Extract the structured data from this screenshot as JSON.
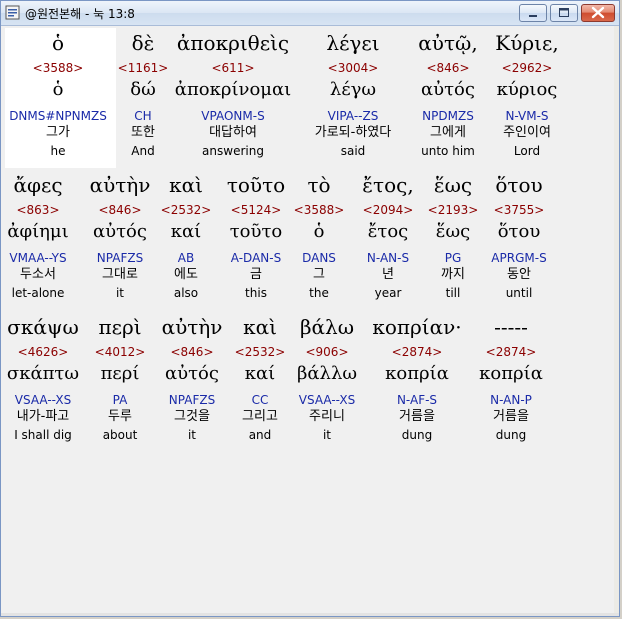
{
  "window": {
    "title": "@원전본해 - 눅 13:8"
  },
  "rows": [
    [
      {
        "greek": "ὁ",
        "strong": "<3588>",
        "lemma": "ὁ",
        "parse": "DNMS#NPNMZS",
        "korean": "그가",
        "english": "he"
      },
      {
        "greek": "δὲ",
        "strong": "<1161>",
        "lemma": "δώ",
        "parse": "CH",
        "korean": "또한",
        "english": "And"
      },
      {
        "greek": "ἀποκριθεὶς",
        "strong": "<611>",
        "lemma": "ἀποκρίνομαι",
        "parse": "VPAONM-S",
        "korean": "대답하여",
        "english": "answering"
      },
      {
        "greek": "λέγει",
        "strong": "<3004>",
        "lemma": "λέγω",
        "parse": "VIPA--ZS",
        "korean": "가로되-하였다",
        "english": "said"
      },
      {
        "greek": "αὐτῷ,",
        "strong": "<846>",
        "lemma": "αὐτός",
        "parse": "NPDMZS",
        "korean": "그에게",
        "english": "unto him"
      },
      {
        "greek": "Κύριε,",
        "strong": "<2962>",
        "lemma": "κύριος",
        "parse": "N-VM-S",
        "korean": "주인이여",
        "english": "Lord"
      }
    ],
    [
      {
        "greek": "ἄφες",
        "strong": "<863>",
        "lemma": "ἀφίημι",
        "parse": "VMAA--YS",
        "korean": "두소서",
        "english": "let-alone"
      },
      {
        "greek": "αὐτὴν",
        "strong": "<846>",
        "lemma": "αὐτός",
        "parse": "NPAFZS",
        "korean": "그대로",
        "english": "it"
      },
      {
        "greek": "καὶ",
        "strong": "<2532>",
        "lemma": "καί",
        "parse": "AB",
        "korean": "에도",
        "english": "also"
      },
      {
        "greek": "τοῦτο",
        "strong": "<5124>",
        "lemma": "τοῦτο",
        "parse": "A-DAN-S",
        "korean": "금",
        "english": "this"
      },
      {
        "greek": "τὸ",
        "strong": "<3588>",
        "lemma": "ὁ",
        "parse": "DANS",
        "korean": "그",
        "english": "the"
      },
      {
        "greek": "ἔτος,",
        "strong": "<2094>",
        "lemma": "ἔτος",
        "parse": "N-AN-S",
        "korean": "년",
        "english": "year"
      },
      {
        "greek": "ἕως",
        "strong": "<2193>",
        "lemma": "ἕως",
        "parse": "PG",
        "korean": "까지",
        "english": "till"
      },
      {
        "greek": "ὅτου",
        "strong": "<3755>",
        "lemma": "ὅτου",
        "parse": "APRGM-S",
        "korean": "동안",
        "english": "until"
      }
    ],
    [
      {
        "greek": "σκάψω",
        "strong": "<4626>",
        "lemma": "σκάπτω",
        "parse": "VSAA--XS",
        "korean": "내가-파고",
        "english": "I shall dig"
      },
      {
        "greek": "περὶ",
        "strong": "<4012>",
        "lemma": "περί",
        "parse": "PA",
        "korean": "두루",
        "english": "about"
      },
      {
        "greek": "αὐτὴν",
        "strong": "<846>",
        "lemma": "αὐτός",
        "parse": "NPAFZS",
        "korean": "그것을",
        "english": "it"
      },
      {
        "greek": "καὶ",
        "strong": "<2532>",
        "lemma": "καί",
        "parse": "CC",
        "korean": "그리고",
        "english": "and"
      },
      {
        "greek": "βάλω",
        "strong": "<906>",
        "lemma": "βάλλω",
        "parse": "VSAA--XS",
        "korean": "주리니",
        "english": "it"
      },
      {
        "greek": "κοπρίαν·",
        "strong": "<2874>",
        "lemma": "κοπρία",
        "parse": "N-AF-S",
        "korean": "거름을",
        "english": "dung"
      },
      {
        "greek": "-----",
        "strong": "<2874>",
        "lemma": "κοπρία",
        "parse": "N-AN-P",
        "korean": "거름을",
        "english": "dung"
      }
    ]
  ],
  "colors": {
    "strong": "#8b0000",
    "parse": "#1a2aa8",
    "text": "#000000",
    "selection": "#ffffff"
  },
  "icons": {
    "app": "app-icon",
    "minimize": "minimize-icon",
    "maximize": "maximize-icon",
    "close": "close-icon"
  }
}
